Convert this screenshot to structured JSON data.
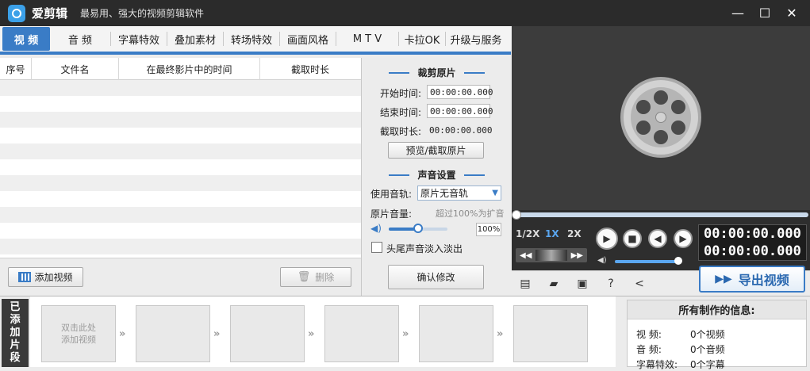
{
  "app": {
    "title": "爱剪辑",
    "subtitle": "最易用、强大的视频剪辑软件"
  },
  "window_buttons": [
    "—",
    "☐",
    "✕"
  ],
  "tabs": [
    {
      "label": "视  频",
      "active": true
    },
    {
      "label": "音  频"
    },
    {
      "label": "字幕特效"
    },
    {
      "label": "叠加素材"
    },
    {
      "label": "转场特效"
    },
    {
      "label": "画面风格"
    },
    {
      "label": "M T V"
    },
    {
      "label": "卡拉OK"
    },
    {
      "label": "升级与服务"
    }
  ],
  "table": {
    "columns": [
      "序号",
      "文件名",
      "在最终影片中的时间",
      "截取时长"
    ]
  },
  "left_footer": {
    "add_video": "添加视频",
    "delete": "删除"
  },
  "trim": {
    "title": "裁剪原片",
    "start_label": "开始时间:",
    "start_value": "00:00:00.000",
    "end_label": "结束时间:",
    "end_value": "00:00:00.000",
    "duration_label": "截取时长:",
    "duration_value": "00:00:00.000",
    "preview_button": "预览/截取原片"
  },
  "sound": {
    "title": "声音设置",
    "track_label": "使用音轨:",
    "track_value": "原片无音轨",
    "volume_label": "原片音量:",
    "volume_hint": "超过100%为扩音",
    "volume_value": "100%",
    "volume_fraction": 0.5,
    "fade_label": "头尾声音淡入淡出",
    "confirm_button": "确认修改"
  },
  "player": {
    "speeds": [
      "1/2X",
      "1X",
      "2X"
    ],
    "time_current": "00:00:00.000",
    "time_total": "00:00:00.000",
    "volume_fraction": 1.0
  },
  "toolbar": {
    "export_label": "导出视频"
  },
  "timeline": {
    "label_chars": [
      "已",
      "添",
      "加",
      "片",
      "段"
    ],
    "first_slot_line1": "双击此处",
    "first_slot_line2": "添加视频"
  },
  "info": {
    "title": "所有制作的信息:",
    "rows": [
      {
        "key": "视      频:",
        "value": "0个视频"
      },
      {
        "key": "音      频:",
        "value": "0个音频"
      },
      {
        "key": "字幕特效:",
        "value": "0个字幕"
      }
    ]
  },
  "colors": {
    "accent": "#3a7cc6",
    "titlebar": "#2b2b2b",
    "player_bg": "#3c3c3c"
  }
}
